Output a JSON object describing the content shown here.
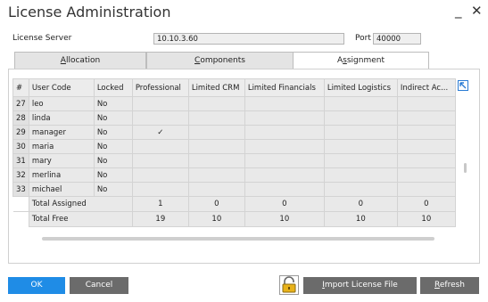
{
  "window": {
    "title": "License Administration",
    "minimize_glyph": "_",
    "close_glyph": "✕"
  },
  "server": {
    "label": "License Server",
    "value": "10.10.3.60",
    "port_label": "Port",
    "port_value": "40000"
  },
  "tabs": [
    {
      "pre": "",
      "u": "A",
      "post": "llocation"
    },
    {
      "pre": "",
      "u": "C",
      "post": "omponents"
    },
    {
      "pre": "A",
      "u": "s",
      "post": "signment"
    }
  ],
  "table": {
    "headers": [
      "#",
      "User Code",
      "Locked",
      "Professional",
      "Limited CRM",
      "Limited Financials",
      "Limited Logistics",
      "Indirect Ac..."
    ],
    "rows": [
      [
        "27",
        "leo",
        "No",
        "",
        "",
        "",
        "",
        ""
      ],
      [
        "28",
        "linda",
        "No",
        "",
        "",
        "",
        "",
        ""
      ],
      [
        "29",
        "manager",
        "No",
        "✓",
        "",
        "",
        "",
        ""
      ],
      [
        "30",
        "maria",
        "No",
        "",
        "",
        "",
        "",
        ""
      ],
      [
        "31",
        "mary",
        "No",
        "",
        "",
        "",
        "",
        ""
      ],
      [
        "32",
        "merlina",
        "No",
        "",
        "",
        "",
        "",
        ""
      ],
      [
        "33",
        "michael",
        "No",
        "",
        "",
        "",
        "",
        ""
      ]
    ],
    "totals": [
      {
        "label": "Total Assigned",
        "values": [
          "1",
          "0",
          "0",
          "0",
          "0"
        ]
      },
      {
        "label": "Total Free",
        "values": [
          "19",
          "10",
          "10",
          "10",
          "10"
        ]
      }
    ]
  },
  "buttons": {
    "ok": "OK",
    "cancel": "Cancel",
    "import": {
      "pre": "",
      "u": "I",
      "post": "mport License File"
    },
    "refresh": {
      "pre": "",
      "u": "R",
      "post": "efresh"
    }
  },
  "icons": {
    "expand": "expand-arrow-icon",
    "lock": "padlock-icon"
  },
  "colors": {
    "accent": "#1f8ce6",
    "button_gray": "#6b6b6b",
    "lock_gold": "#e8b21a"
  }
}
